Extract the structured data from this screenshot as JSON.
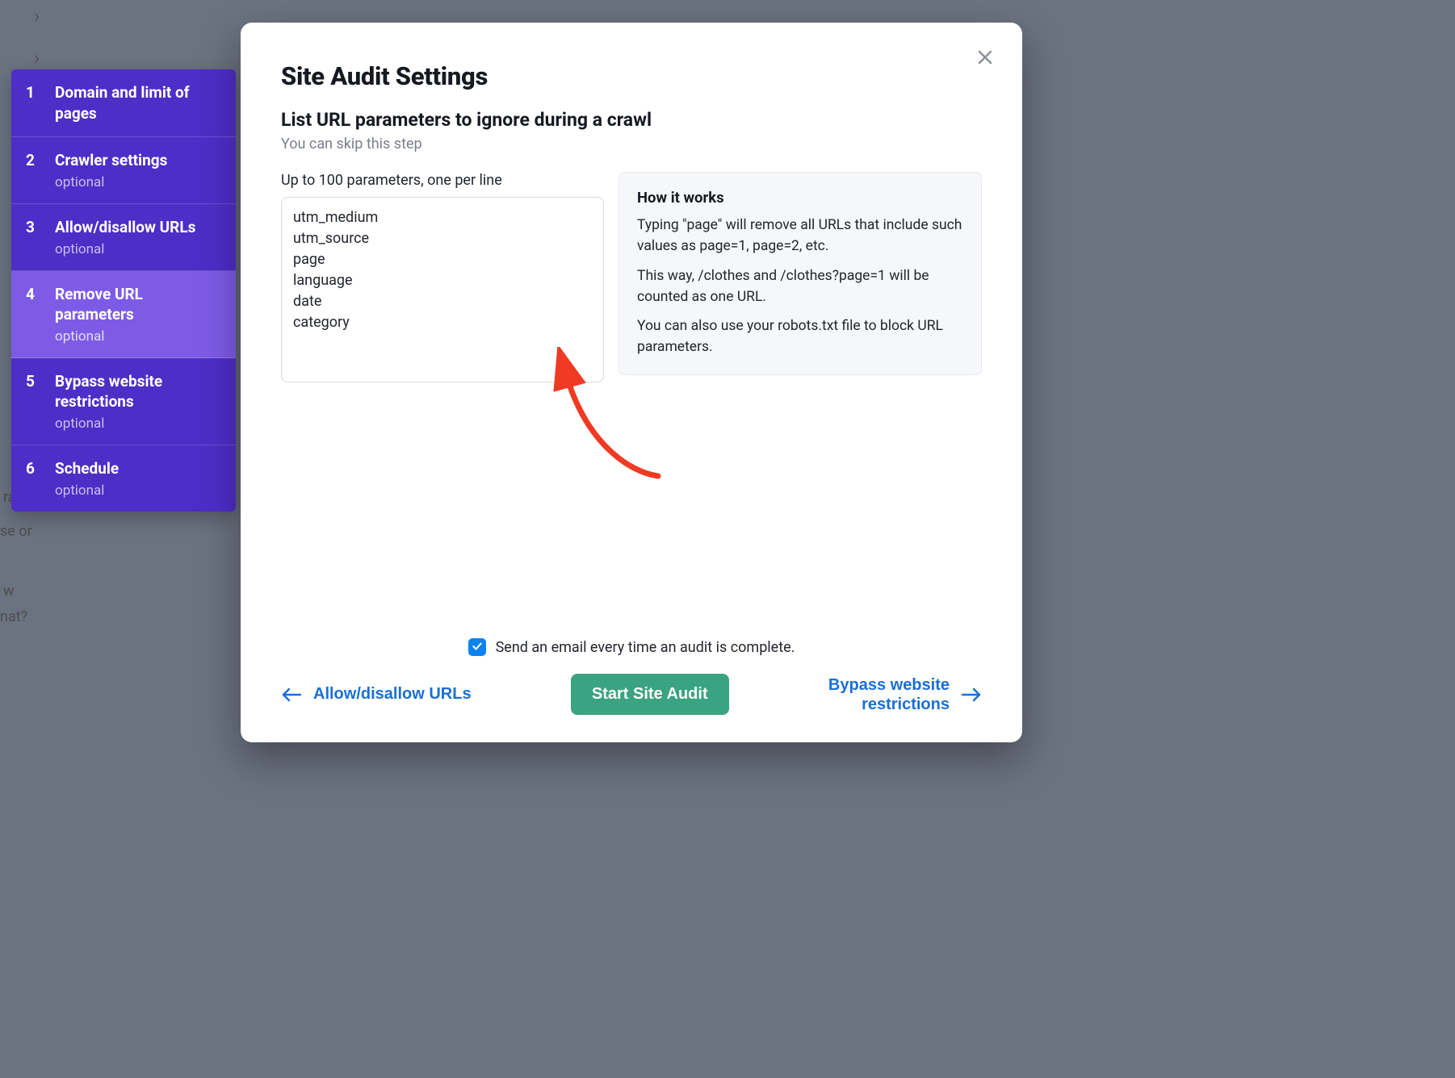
{
  "backdrop": {
    "chev1": "›",
    "chev2": "›",
    "txt1": "ram",
    "txt2": "se or",
    "txt3": "w",
    "txt4": "nat?"
  },
  "sidebar": {
    "steps": [
      {
        "num": "1",
        "title": "Domain and limit of pages",
        "sub": null,
        "active": false
      },
      {
        "num": "2",
        "title": "Crawler settings",
        "sub": "optional",
        "active": false
      },
      {
        "num": "3",
        "title": "Allow/disallow URLs",
        "sub": "optional",
        "active": false
      },
      {
        "num": "4",
        "title": "Remove URL parameters",
        "sub": "optional",
        "active": true
      },
      {
        "num": "5",
        "title": "Bypass website restrictions",
        "sub": "optional",
        "active": false
      },
      {
        "num": "6",
        "title": "Schedule",
        "sub": "optional",
        "active": false
      }
    ]
  },
  "modal": {
    "title": "Site Audit Settings",
    "subheading": "List URL parameters to ignore during a crawl",
    "subheading_note": "You can skip this step",
    "textarea_label": "Up to 100 parameters, one per line",
    "textarea_value": "utm_medium\nutm_source\npage\nlanguage\ndate\ncategory",
    "info": {
      "title": "How it works",
      "p1": "Typing \"page\" will remove all URLs that include such values as page=1, page=2, etc.",
      "p2": "This way, /clothes and /clothes?page=1 will be counted as one URL.",
      "p3": "You can also use your robots.txt file to block URL parameters."
    },
    "email_checkbox_label": "Send an email every time an audit is complete.",
    "email_checkbox_checked": true,
    "prev_label": "Allow/disallow URLs",
    "start_label": "Start Site Audit",
    "next_label_line1": "Bypass website",
    "next_label_line2": "restrictions"
  }
}
